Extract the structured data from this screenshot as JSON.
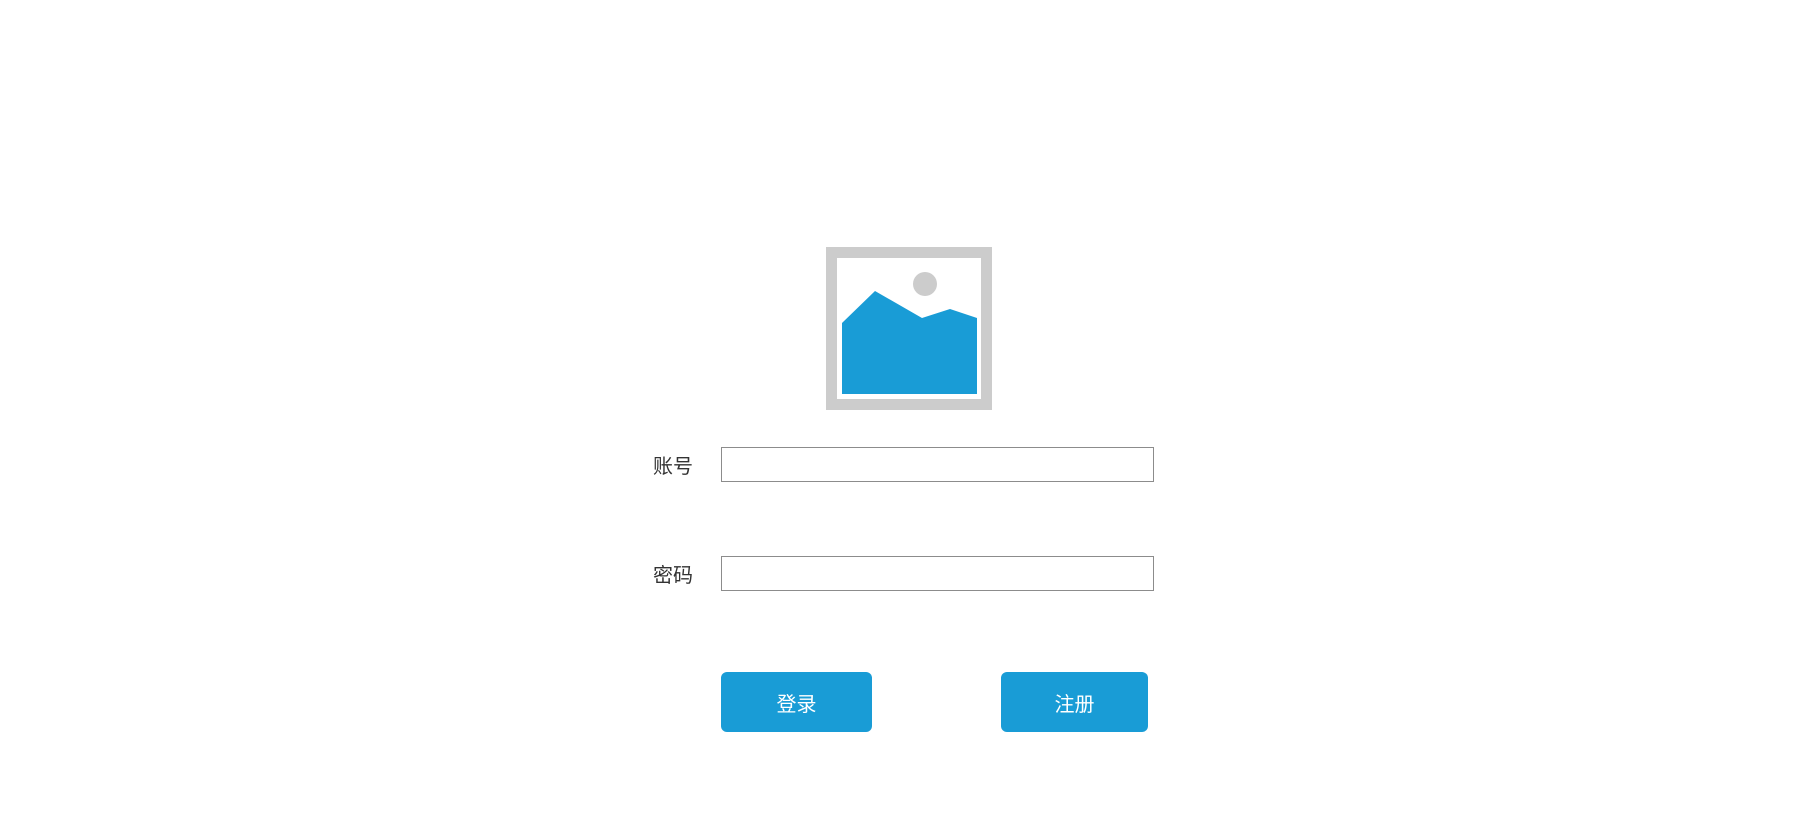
{
  "logo": {
    "icon": "image-placeholder-icon",
    "frame_color": "#cccccc",
    "fill_color": "#199cd6"
  },
  "form": {
    "account_label": "账号",
    "account_value": "",
    "account_placeholder": "",
    "password_label": "密码",
    "password_value": "",
    "password_placeholder": ""
  },
  "actions": {
    "login_label": "登录",
    "register_label": "注册"
  },
  "colors": {
    "accent": "#199cd6",
    "label_text": "#333333",
    "input_border": "#8c8c8c"
  }
}
